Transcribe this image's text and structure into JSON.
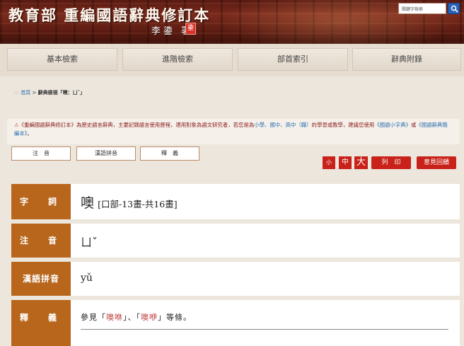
{
  "header": {
    "site_title": "教育部 重編國語辭典修訂本",
    "author": "李鍌 署",
    "seal": "鍌",
    "search_placeholder": "關鍵字檢索"
  },
  "nav": {
    "items": [
      {
        "label": "基本檢索"
      },
      {
        "label": "進階檢索"
      },
      {
        "label": "部首索引"
      },
      {
        "label": "辭典附錄"
      }
    ]
  },
  "breadcrumb": {
    "prefix": ":::",
    "home": "首頁",
    "sep": ">",
    "current": "辭典檢視「噢：ㄩˇ」"
  },
  "notice": {
    "text1": "《重編國語辭典修訂本》為歷史語言辭典，主要記錄語言使用歷程，適用對象為語文研究者，若您是為",
    "school_link": "小學、國中、高中（職）",
    "text2": "的學習或教學，建議您使用",
    "link1": "《國語小字典》",
    "or": "或",
    "link2": "《國語辭典簡編本》",
    "end": "。"
  },
  "tabs": [
    {
      "label": "注　音"
    },
    {
      "label": "漢語拼音"
    },
    {
      "label": "釋　義"
    }
  ],
  "font_size": {
    "small": "小",
    "medium": "中",
    "large": "大"
  },
  "actions": {
    "print": "列　印",
    "feedback": "意見回饋"
  },
  "entry": {
    "word_label": "字　詞",
    "word": "噢",
    "radical_info": "[口部-13畫-共16畫]",
    "zhuyin_label": "注　音",
    "zhuyin": "ㄩˇ",
    "pinyin_label": "漢語拼音",
    "pinyin": "yǔ",
    "definition_label": "釋　義",
    "def_prefix": "參見「",
    "def_link1": "噢咻",
    "def_mid": "」、「",
    "def_link2": "噢咿",
    "def_suffix": "」等條。"
  },
  "colors": {
    "header_bg": "#6a2418",
    "label_bg": "#b8661c",
    "accent_red": "#c8221a",
    "link_blue": "#2a6db0"
  }
}
